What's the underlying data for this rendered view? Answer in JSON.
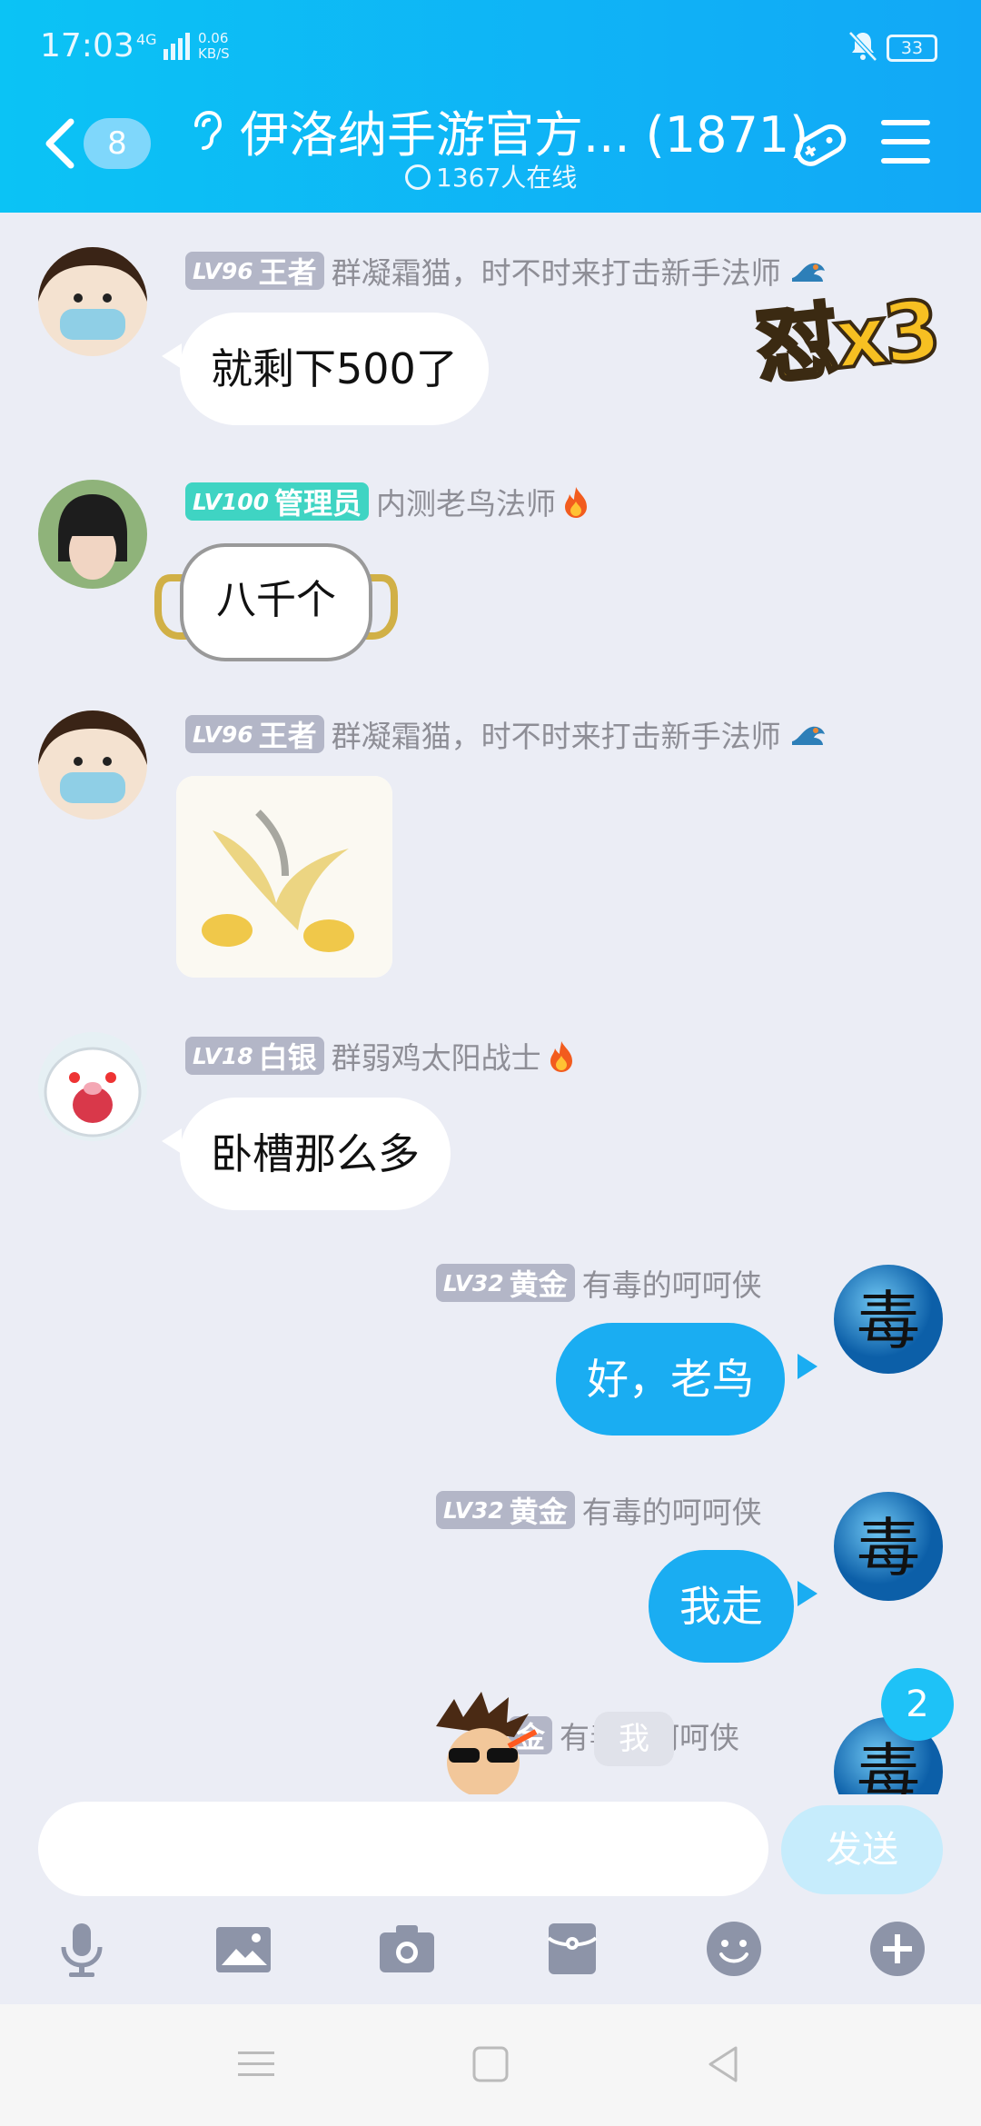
{
  "status": {
    "time": "17:03",
    "network": "4G",
    "speed_value": "0.06",
    "speed_unit": "KB/S",
    "battery": "33"
  },
  "header": {
    "unread_count": "8",
    "title": "伊洛纳手游官方... (1871)",
    "online": "1367人在线"
  },
  "messages": [
    {
      "level": "LV96",
      "rank": "王者",
      "name": "群凝霜猫，时不时来打击新手法师",
      "text": "就剩下500了"
    },
    {
      "level": "LV100",
      "rank": "管理员",
      "name": "内测老鸟法师",
      "sticker_text": "八千个"
    },
    {
      "level": "LV96",
      "rank": "王者",
      "name": "群凝霜猫，时不时来打击新手法师"
    },
    {
      "level": "LV18",
      "rank": "白银",
      "name": "群弱鸡太阳战士",
      "text": "卧槽那么多"
    },
    {
      "level": "LV32",
      "rank": "黄金",
      "name": "有毒的呵呵侠",
      "text": "好，老鸟"
    },
    {
      "level": "LV32",
      "rank": "黄金",
      "name": "有毒的呵呵侠",
      "text": "我走"
    },
    {
      "rank_partial": "金",
      "name": "有毒的呵呵侠",
      "text": "我"
    }
  ],
  "sticker_overlay": "怼x3",
  "new_messages_count": "2",
  "composer": {
    "placeholder": "",
    "send_label": "发送"
  },
  "colors": {
    "header": "#12a8f6",
    "bubble_self": "#1aadf2",
    "badge_admin": "#3fd4c3",
    "badge_default": "#b3b6c7",
    "background": "#ebedf5"
  },
  "toolbar_icons": [
    "microphone-icon",
    "image-icon",
    "camera-icon",
    "red-packet-icon",
    "emoji-icon",
    "plus-icon"
  ]
}
